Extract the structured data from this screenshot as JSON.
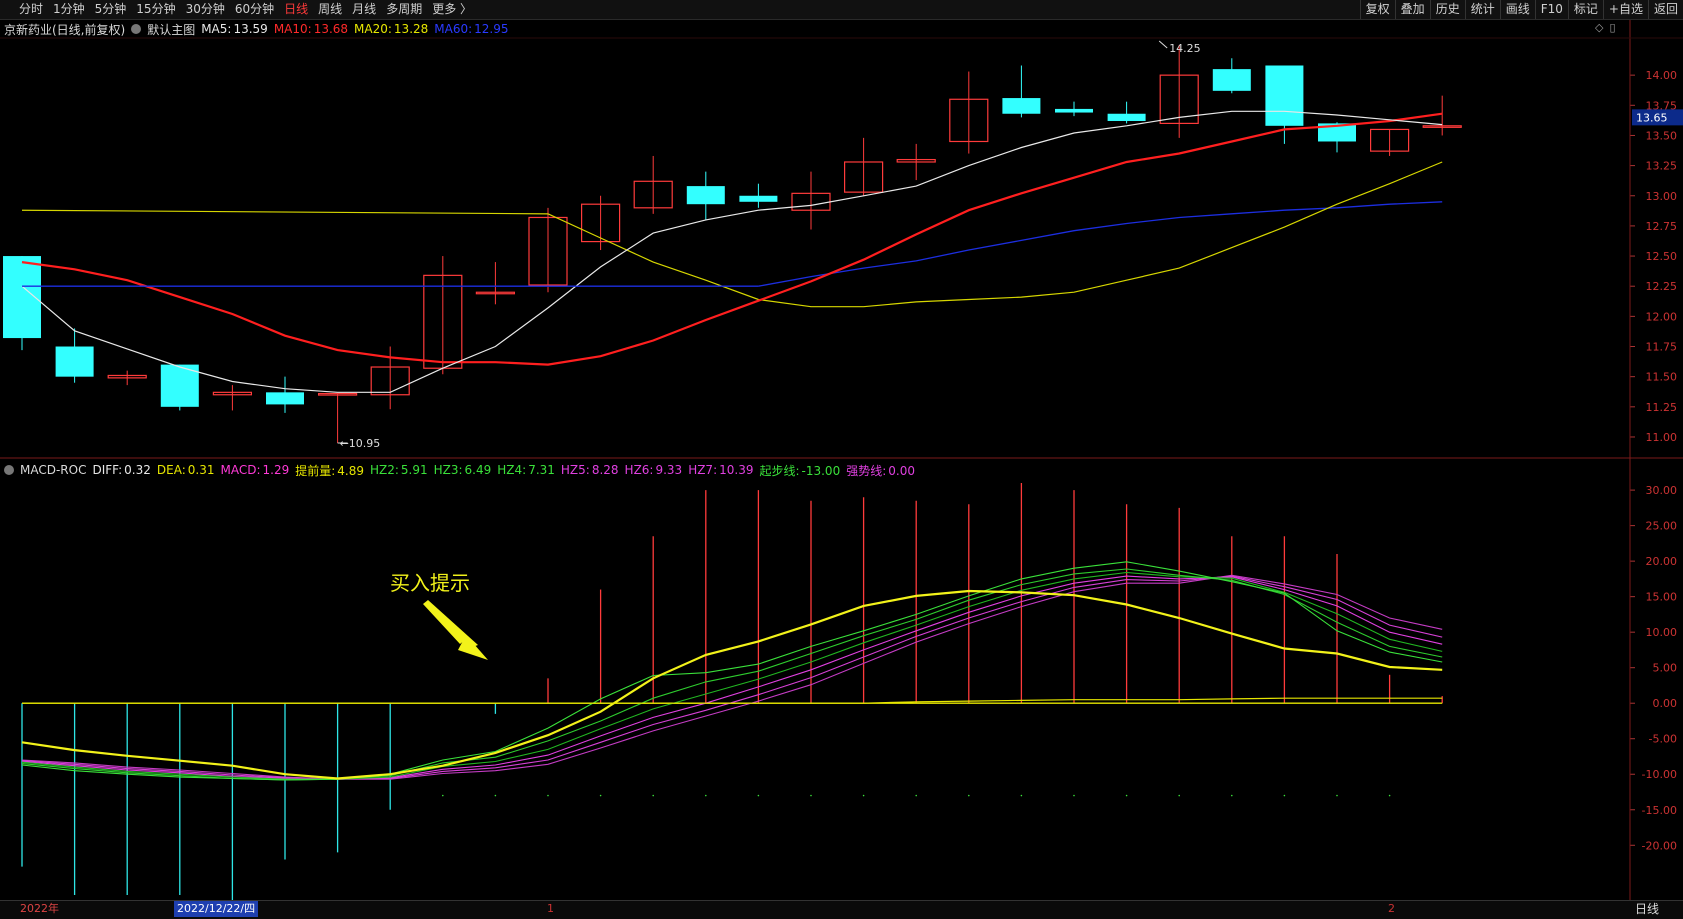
{
  "toolbar": {
    "periods": [
      "分时",
      "1分钟",
      "5分钟",
      "15分钟",
      "30分钟",
      "60分钟",
      "日线",
      "周线",
      "月线",
      "多周期",
      "更多 〉"
    ],
    "active_period": "日线",
    "tools": [
      "复权",
      "叠加",
      "历史",
      "统计",
      "画线",
      "F10",
      "标记",
      "+自选",
      "返回"
    ]
  },
  "main_chart": {
    "stock": "京新药业(日线,前复权)",
    "template": "默认主图",
    "ma": [
      {
        "label": "MA5:",
        "value": "13.59",
        "color": "#e8e8e8"
      },
      {
        "label": "MA10:",
        "value": "13.68",
        "color": "#ff2a2a"
      },
      {
        "label": "MA20:",
        "value": "13.28",
        "color": "#e6e600"
      },
      {
        "label": "MA60:",
        "value": "12.95",
        "color": "#2a3aff"
      }
    ],
    "price_ticks": [
      "14.00",
      "13.75",
      "13.50",
      "13.25",
      "13.00",
      "12.75",
      "12.50",
      "12.25",
      "12.00",
      "11.75",
      "11.50",
      "11.25",
      "11.00"
    ],
    "current_price": "13.65",
    "high_label": "14.25",
    "low_label": "10.95",
    "colors": {
      "up": "#ff3b3b",
      "down": "#3ff",
      "ma5": "#e8e8e8",
      "ma10": "#ff1f1f",
      "ma20": "#d6d600",
      "ma60": "#1c2ee0"
    },
    "candles": [
      {
        "o": 12.5,
        "h": 12.5,
        "l": 11.72,
        "c": 11.82
      },
      {
        "o": 11.75,
        "h": 11.9,
        "l": 11.45,
        "c": 11.5
      },
      {
        "o": 11.49,
        "h": 11.55,
        "l": 11.43,
        "c": 11.51
      },
      {
        "o": 11.6,
        "h": 11.6,
        "l": 11.22,
        "c": 11.25
      },
      {
        "o": 11.35,
        "h": 11.43,
        "l": 11.22,
        "c": 11.37
      },
      {
        "o": 11.37,
        "h": 11.5,
        "l": 11.2,
        "c": 11.27
      },
      {
        "o": 11.36,
        "h": 11.36,
        "l": 10.95,
        "c": 11.36
      },
      {
        "o": 11.35,
        "h": 11.75,
        "l": 11.23,
        "c": 11.58
      },
      {
        "o": 11.57,
        "h": 12.5,
        "l": 11.52,
        "c": 12.34
      },
      {
        "o": 12.2,
        "h": 12.45,
        "l": 12.1,
        "c": 12.2
      },
      {
        "o": 12.26,
        "h": 12.9,
        "l": 12.2,
        "c": 12.82
      },
      {
        "o": 12.62,
        "h": 13.0,
        "l": 12.55,
        "c": 12.93
      },
      {
        "o": 12.9,
        "h": 13.33,
        "l": 12.85,
        "c": 13.12
      },
      {
        "o": 13.08,
        "h": 13.2,
        "l": 12.8,
        "c": 12.93
      },
      {
        "o": 13.0,
        "h": 13.1,
        "l": 12.9,
        "c": 12.95
      },
      {
        "o": 12.88,
        "h": 13.2,
        "l": 12.72,
        "c": 13.02
      },
      {
        "o": 13.03,
        "h": 13.48,
        "l": 13.0,
        "c": 13.28
      },
      {
        "o": 13.28,
        "h": 13.43,
        "l": 13.13,
        "c": 13.3
      },
      {
        "o": 13.45,
        "h": 14.03,
        "l": 13.35,
        "c": 13.8
      },
      {
        "o": 13.81,
        "h": 14.08,
        "l": 13.65,
        "c": 13.68
      },
      {
        "o": 13.72,
        "h": 13.78,
        "l": 13.66,
        "c": 13.69
      },
      {
        "o": 13.68,
        "h": 13.78,
        "l": 13.6,
        "c": 13.62
      },
      {
        "o": 13.6,
        "h": 14.25,
        "l": 13.48,
        "c": 14.0
      },
      {
        "o": 14.05,
        "h": 14.14,
        "l": 13.85,
        "c": 13.87
      },
      {
        "o": 14.08,
        "h": 14.08,
        "l": 13.43,
        "c": 13.58
      },
      {
        "o": 13.6,
        "h": 13.61,
        "l": 13.36,
        "c": 13.45
      },
      {
        "o": 13.37,
        "h": 13.55,
        "l": 13.33,
        "c": 13.55
      },
      {
        "o": 13.57,
        "h": 13.83,
        "l": 13.5,
        "c": 13.58
      }
    ],
    "ma5_series": [
      12.25,
      11.88,
      11.73,
      11.58,
      11.46,
      11.4,
      11.37,
      11.37,
      11.57,
      11.75,
      12.07,
      12.41,
      12.69,
      12.8,
      12.88,
      12.92,
      13.0,
      13.08,
      13.25,
      13.4,
      13.52,
      13.58,
      13.65,
      13.7,
      13.7,
      13.67,
      13.63,
      13.59
    ],
    "ma10_series": [
      12.45,
      12.39,
      12.3,
      12.16,
      12.02,
      11.84,
      11.72,
      11.66,
      11.62,
      11.62,
      11.6,
      11.67,
      11.8,
      11.97,
      12.13,
      12.29,
      12.47,
      12.68,
      12.88,
      13.02,
      13.15,
      13.28,
      13.35,
      13.45,
      13.55,
      13.58,
      13.62,
      13.68
    ],
    "ma20_series": [
      12.85,
      12.65,
      12.45,
      12.3,
      12.14,
      12.08,
      12.08,
      12.12,
      12.14,
      12.16,
      12.2,
      12.3,
      12.4,
      12.57,
      12.74,
      12.93,
      13.1,
      13.28
    ],
    "ma60_series": [
      12.25,
      12.33,
      12.4,
      12.46,
      12.55,
      12.63,
      12.71,
      12.77,
      12.82,
      12.85,
      12.88,
      12.9,
      12.93,
      12.95
    ]
  },
  "macd_chart": {
    "label": "MACD-ROC",
    "indicators": [
      {
        "label": "DIFF:",
        "value": "0.32",
        "color": "#e8e8e8"
      },
      {
        "label": "DEA:",
        "value": "0.31",
        "color": "#e6e600"
      },
      {
        "label": "MACD:",
        "value": "1.29",
        "color": "#ff3ad7"
      },
      {
        "label": "提前量:",
        "value": "4.89",
        "color": "#e6e600"
      },
      {
        "label": "HZ2:",
        "value": "5.91",
        "color": "#3ae03a"
      },
      {
        "label": "HZ3:",
        "value": "6.49",
        "color": "#3ae03a"
      },
      {
        "label": "HZ4:",
        "value": "7.31",
        "color": "#3ae03a"
      },
      {
        "label": "HZ5:",
        "value": "8.28",
        "color": "#e040e0"
      },
      {
        "label": "HZ6:",
        "value": "9.33",
        "color": "#e040e0"
      },
      {
        "label": "HZ7:",
        "value": "10.39",
        "color": "#e040e0"
      },
      {
        "label": "起步线:",
        "value": "-13.00",
        "color": "#3ae03a"
      },
      {
        "label": "强势线:",
        "value": "0.00",
        "color": "#e040e0"
      }
    ],
    "ticks": [
      "30.00",
      "25.00",
      "20.00",
      "15.00",
      "10.00",
      "5.00",
      "0.00",
      "-5.00",
      "-10.00",
      "-15.00",
      "-20.00"
    ],
    "annotation": "买入提示",
    "bars": [
      -23,
      -27,
      -27,
      -27,
      -28,
      -22,
      -21,
      -15,
      0,
      -1.5,
      3.5,
      16,
      23.5,
      30,
      30,
      28.5,
      29,
      28.5,
      28,
      31,
      30,
      28,
      27.5,
      23.5,
      23.5,
      21,
      4,
      1
    ],
    "yellow": [
      -5.5,
      -6.6,
      -7.4,
      -8.1,
      -8.8,
      -10.0,
      -10.6,
      -10.0,
      -8.8,
      -7.0,
      -4.5,
      -1.2,
      3.5,
      6.8,
      8.7,
      11.1,
      13.7,
      15.1,
      15.8,
      15.6,
      15.2,
      13.9,
      12.0,
      9.8,
      7.7,
      7.0,
      5.1,
      4.7
    ],
    "hz2": [
      -8.7,
      -9.5,
      -10.0,
      -10.4,
      -10.6,
      -10.8,
      -10.7,
      -10.0,
      -8.0,
      -6.8,
      -3.5,
      0.6,
      3.9,
      4.3,
      5.5,
      8.0,
      10.2,
      12.5,
      15.1,
      17.5,
      19.0,
      19.9,
      18.6,
      17.1,
      15.5,
      10.2,
      7.2,
      5.8
    ],
    "hz3": [
      -8.5,
      -9.2,
      -9.8,
      -10.2,
      -10.6,
      -10.8,
      -10.7,
      -10.2,
      -8.4,
      -7.6,
      -5.3,
      -2.5,
      0.7,
      3.0,
      4.5,
      7.0,
      9.5,
      11.8,
      14.5,
      16.7,
      18.2,
      18.9,
      18.0,
      17.3,
      15.3,
      11.4,
      8.0,
      6.5
    ],
    "hz4": [
      -8.3,
      -9.0,
      -9.6,
      -10.0,
      -10.4,
      -10.7,
      -10.7,
      -10.4,
      -8.9,
      -8.2,
      -6.5,
      -3.6,
      -0.8,
      1.3,
      3.4,
      5.8,
      8.5,
      11.0,
      13.6,
      15.9,
      17.5,
      18.4,
      17.8,
      17.6,
      15.6,
      12.6,
      9.0,
      7.3
    ],
    "hz5": [
      -8.2,
      -8.8,
      -9.4,
      -9.8,
      -10.3,
      -10.6,
      -10.7,
      -10.5,
      -9.3,
      -8.7,
      -7.3,
      -4.6,
      -2.0,
      0.0,
      2.3,
      4.7,
      7.5,
      10.2,
      12.8,
      15.1,
      16.9,
      17.9,
      17.5,
      17.8,
      16.0,
      13.7,
      10.0,
      8.3
    ],
    "hz6": [
      -8.1,
      -8.6,
      -9.2,
      -9.6,
      -10.1,
      -10.5,
      -10.7,
      -10.6,
      -9.6,
      -9.1,
      -8.0,
      -5.5,
      -3.0,
      -1.0,
      1.2,
      3.6,
      6.5,
      9.4,
      12.0,
      14.3,
      16.3,
      17.4,
      17.2,
      17.9,
      16.4,
      14.6,
      11.0,
      9.3
    ],
    "hz7": [
      -8.0,
      -8.4,
      -9.0,
      -9.4,
      -9.9,
      -10.4,
      -10.7,
      -10.7,
      -9.9,
      -9.5,
      -8.6,
      -6.3,
      -3.9,
      -1.8,
      0.3,
      2.6,
      5.6,
      8.6,
      11.2,
      13.6,
      15.7,
      16.9,
      16.9,
      18.0,
      16.8,
      15.3,
      12.0,
      10.4
    ],
    "dea_series": [
      0,
      0,
      0,
      0,
      0,
      0,
      0,
      0,
      0,
      0,
      0,
      0,
      0,
      0,
      0,
      0,
      0,
      0.2,
      0.3,
      0.4,
      0.5,
      0.5,
      0.5,
      0.6,
      0.7,
      0.7,
      0.7,
      0.7
    ]
  },
  "bottom_bar": {
    "year_label": "2022年",
    "cursor_date": "2022/12/22/四",
    "month_marks": [
      "1",
      "2"
    ],
    "period": "日线"
  }
}
